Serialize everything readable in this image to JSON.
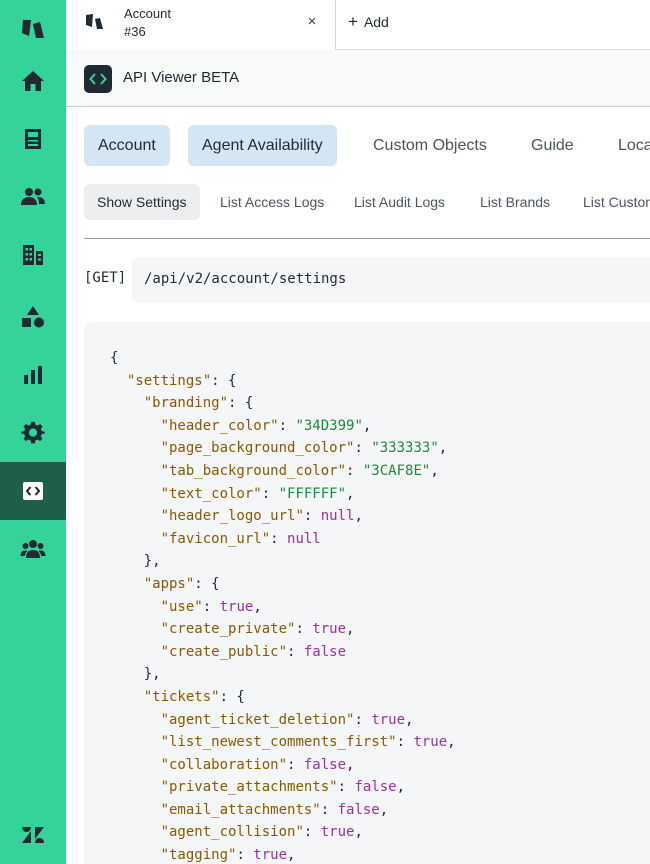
{
  "tab": {
    "title": "Account",
    "subtitle": "#36",
    "close_glyph": "×"
  },
  "add_button": {
    "plus": "+",
    "label": "Add"
  },
  "app": {
    "title": "API Viewer BETA",
    "icon": "code-icon"
  },
  "sidebar": {
    "items": [
      {
        "icon": "zendesk-logo-icon"
      },
      {
        "icon": "home-icon"
      },
      {
        "icon": "views-icon"
      },
      {
        "icon": "customers-icon"
      },
      {
        "icon": "organizations-icon"
      },
      {
        "icon": "objects-icon"
      },
      {
        "icon": "reporting-icon"
      },
      {
        "icon": "admin-gear-icon"
      },
      {
        "icon": "api-viewer-code-icon",
        "active": true
      },
      {
        "icon": "team-icon"
      },
      {
        "icon": "zendesk-z-icon"
      }
    ]
  },
  "categories": [
    "Account",
    "Agent Availability",
    "Custom Objects",
    "Guide",
    "Loca"
  ],
  "endpoints": [
    "Show Settings",
    "List Access Logs",
    "List Audit Logs",
    "List Brands",
    "List Custon"
  ],
  "request": {
    "method": "[GET]",
    "path": "/api/v2/account/settings"
  },
  "json_lines": [
    {
      "i": 0,
      "p": "{"
    },
    {
      "i": 1,
      "k": "\"settings\"",
      "p": ": {"
    },
    {
      "i": 2,
      "k": "\"branding\"",
      "p": ": {"
    },
    {
      "i": 3,
      "k": "\"header_color\"",
      "p": ": ",
      "s": "\"34D399\"",
      "t": ","
    },
    {
      "i": 3,
      "k": "\"page_background_color\"",
      "p": ": ",
      "s": "\"333333\"",
      "t": ","
    },
    {
      "i": 3,
      "k": "\"tab_background_color\"",
      "p": ": ",
      "s": "\"3CAF8E\"",
      "t": ","
    },
    {
      "i": 3,
      "k": "\"text_color\"",
      "p": ": ",
      "s": "\"FFFFFF\"",
      "t": ","
    },
    {
      "i": 3,
      "k": "\"header_logo_url\"",
      "p": ": ",
      "v": "null",
      "t": ","
    },
    {
      "i": 3,
      "k": "\"favicon_url\"",
      "p": ": ",
      "v": "null"
    },
    {
      "i": 2,
      "p": "},"
    },
    {
      "i": 2,
      "k": "\"apps\"",
      "p": ": {"
    },
    {
      "i": 3,
      "k": "\"use\"",
      "p": ": ",
      "v": "true",
      "t": ","
    },
    {
      "i": 3,
      "k": "\"create_private\"",
      "p": ": ",
      "v": "true",
      "t": ","
    },
    {
      "i": 3,
      "k": "\"create_public\"",
      "p": ": ",
      "v": "false"
    },
    {
      "i": 2,
      "p": "},"
    },
    {
      "i": 2,
      "k": "\"tickets\"",
      "p": ": {"
    },
    {
      "i": 3,
      "k": "\"agent_ticket_deletion\"",
      "p": ": ",
      "v": "true",
      "t": ","
    },
    {
      "i": 3,
      "k": "\"list_newest_comments_first\"",
      "p": ": ",
      "v": "true",
      "t": ","
    },
    {
      "i": 3,
      "k": "\"collaboration\"",
      "p": ": ",
      "v": "false",
      "t": ","
    },
    {
      "i": 3,
      "k": "\"private_attachments\"",
      "p": ": ",
      "v": "false",
      "t": ","
    },
    {
      "i": 3,
      "k": "\"email_attachments\"",
      "p": ": ",
      "v": "false",
      "t": ","
    },
    {
      "i": 3,
      "k": "\"agent_collision\"",
      "p": ": ",
      "v": "true",
      "t": ","
    },
    {
      "i": 3,
      "k": "\"tagging\"",
      "p": ": ",
      "v": "true",
      "t": ","
    }
  ]
}
